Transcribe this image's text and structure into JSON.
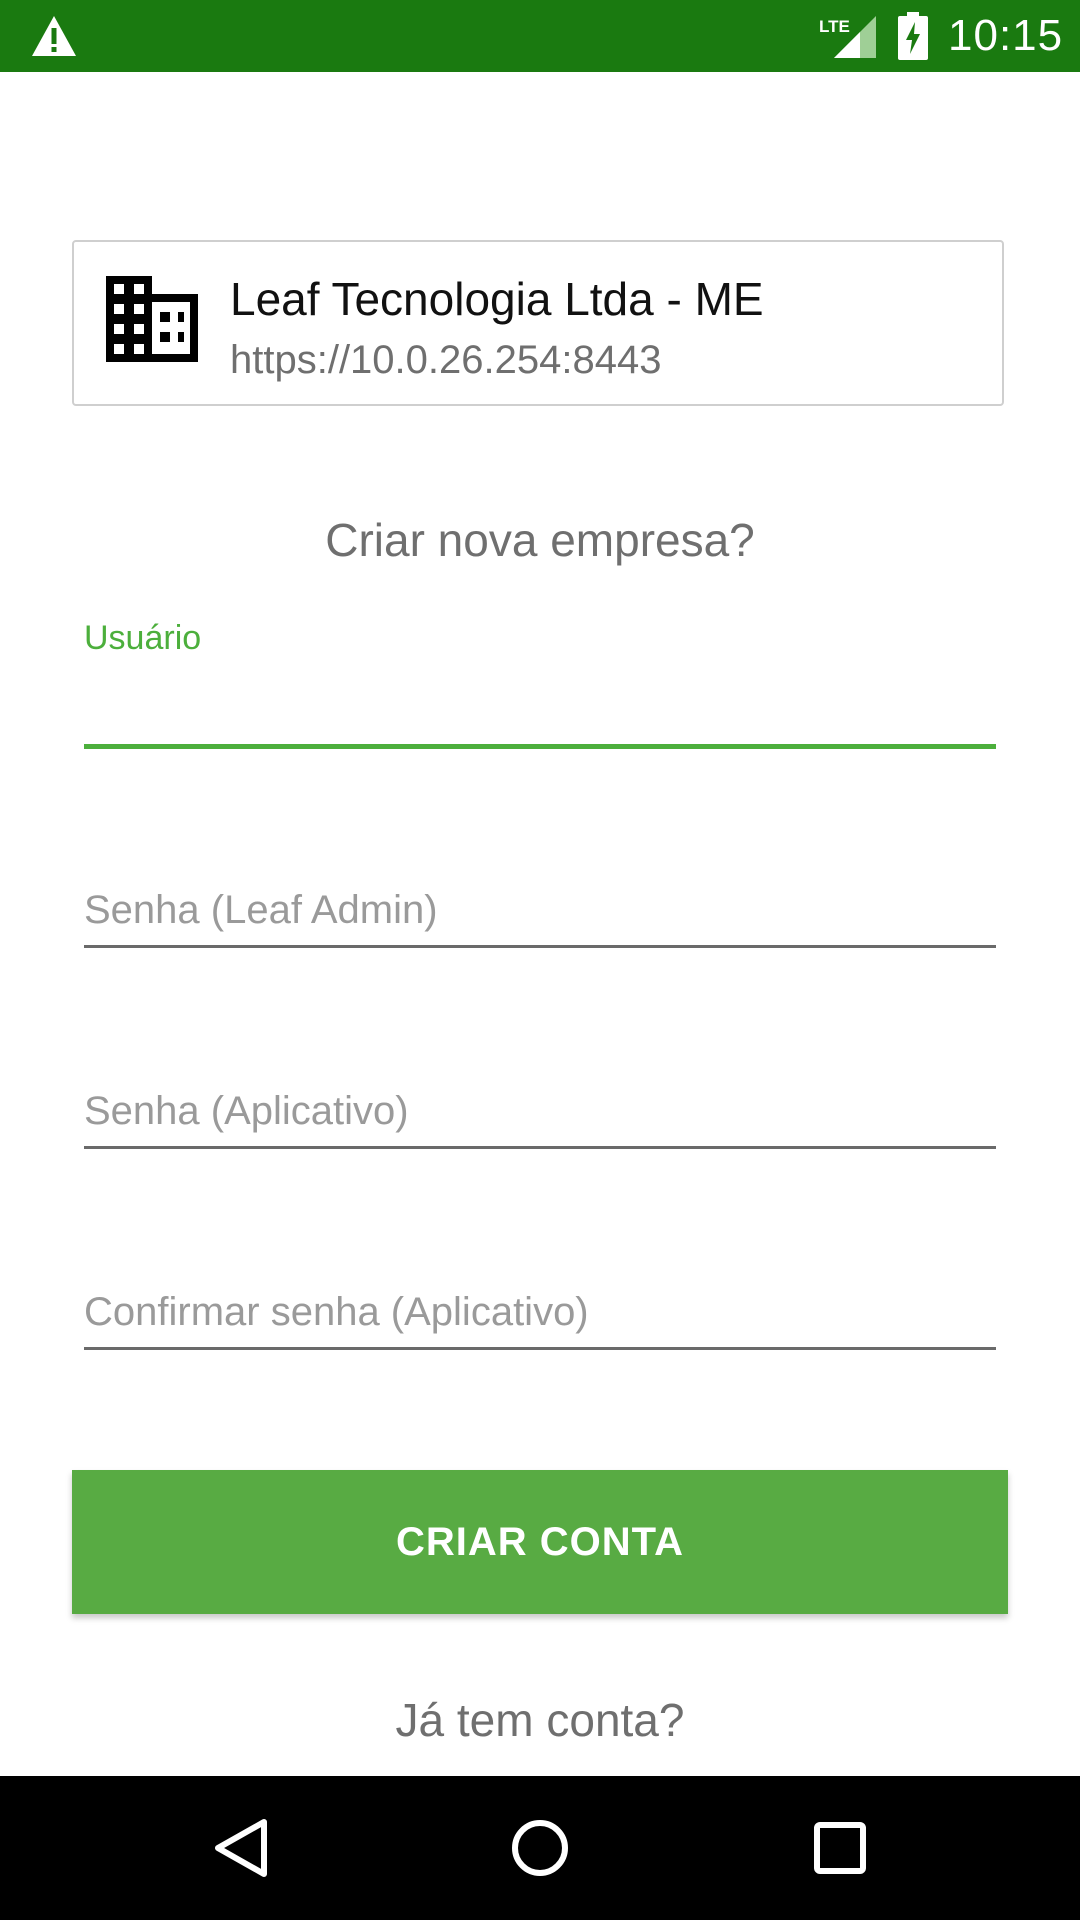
{
  "status_bar": {
    "time": "10:15",
    "network": "LTE",
    "icons": [
      "warning-icon",
      "signal-icon",
      "battery-charging-icon"
    ]
  },
  "server_card": {
    "icon": "building-icon",
    "company_name": "Leaf Tecnologia Ltda - ME",
    "server_url": "https://10.0.26.254:8443"
  },
  "form": {
    "heading": "Criar nova empresa?",
    "username": {
      "label": "Usuário",
      "value": ""
    },
    "admin_password": {
      "placeholder": "Senha (Leaf Admin)",
      "value": ""
    },
    "app_password": {
      "placeholder": "Senha (Aplicativo)",
      "value": ""
    },
    "confirm_password": {
      "placeholder": "Confirmar senha (Aplicativo)",
      "value": ""
    },
    "submit_label": "CRIAR CONTA",
    "login_link": "Já tem conta?"
  },
  "nav_bar": {
    "icons": [
      "back-icon",
      "home-icon",
      "recents-icon"
    ]
  },
  "colors": {
    "status_bar": "#1a7a10",
    "accent": "#58ab43",
    "focused_label": "#4caf3c",
    "muted_text": "#6f6f6f",
    "hint_text": "#9a9a9a"
  }
}
